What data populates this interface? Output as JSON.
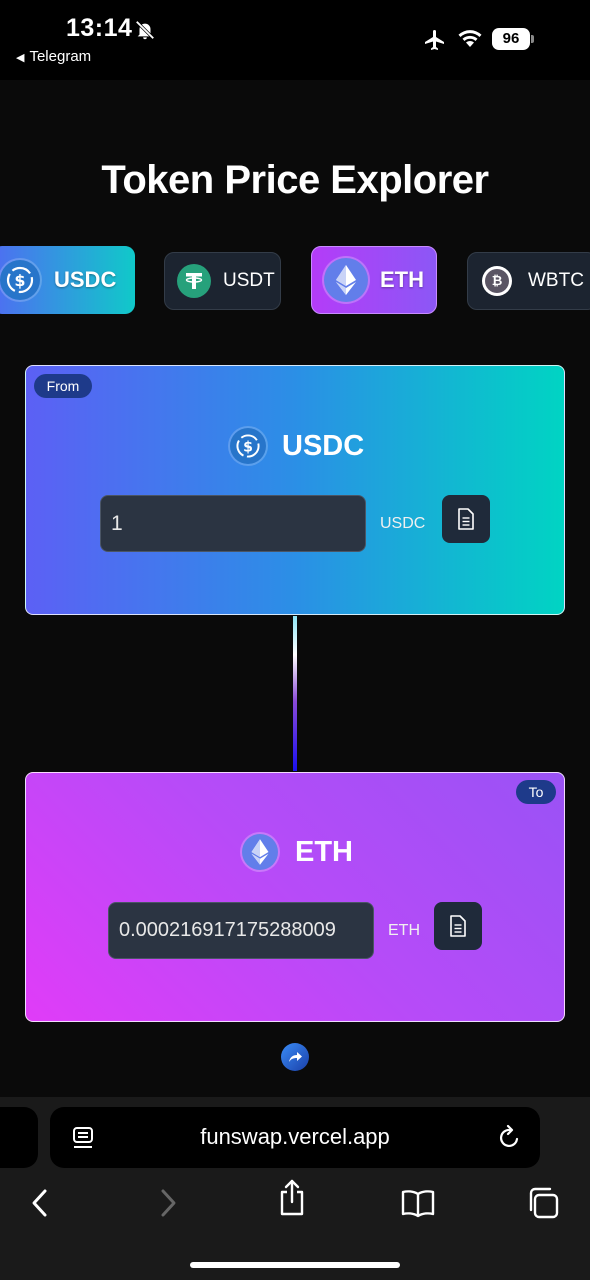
{
  "status_bar": {
    "time": "13:14",
    "back_app": "Telegram",
    "battery": "96",
    "icons": [
      "bell-muted-icon",
      "airplane-icon",
      "wifi-icon",
      "battery-icon"
    ]
  },
  "page": {
    "title": "Token Price Explorer"
  },
  "tokens": [
    {
      "symbol": "USDC",
      "selected": true,
      "icon": "usdc-icon",
      "color": "#2775ca"
    },
    {
      "symbol": "USDT",
      "selected": false,
      "icon": "usdt-icon",
      "color": "#26a17b"
    },
    {
      "symbol": "ETH",
      "selected": true,
      "icon": "eth-icon",
      "color": "#627eea"
    },
    {
      "symbol": "WBTC",
      "selected": false,
      "icon": "wbtc-icon",
      "color": "#5a5564"
    }
  ],
  "from_card": {
    "badge": "From",
    "token": "USDC",
    "amount": "1",
    "unit": "USDC"
  },
  "to_card": {
    "badge": "To",
    "token": "ETH",
    "amount": "0.000216917175288009",
    "unit": "ETH"
  },
  "browser": {
    "url": "funswap.vercel.app"
  },
  "colors": {
    "background": "#0a0a0a",
    "from_gradient": [
      "#5c60f5",
      "#00d4c3"
    ],
    "to_gradient": [
      "#e03cf8",
      "#9a52f5"
    ],
    "badge": "#1e3a8a"
  }
}
